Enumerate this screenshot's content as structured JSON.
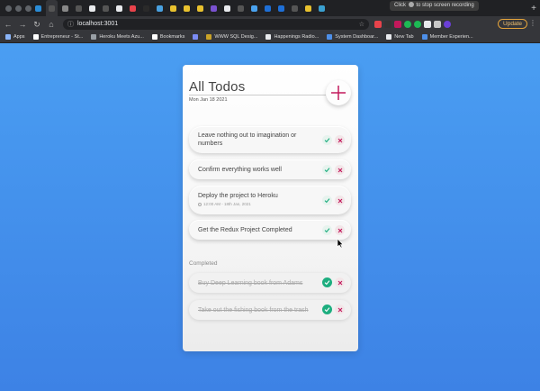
{
  "browser": {
    "tooltip": "Click",
    "tooltip_after": "to stop screen recording",
    "new_tab_glyph": "+",
    "url": "localhost:3001",
    "update_label": "Update",
    "bookmarks": [
      {
        "label": "Apps",
        "color": "#8ab4f8"
      },
      {
        "label": "Entrepreneur - St...",
        "color": "#ffffff"
      },
      {
        "label": "Heroku Meets Azu...",
        "color": "#9aa0a6"
      },
      {
        "label": "Bookmarks",
        "color": "#ffffff"
      },
      {
        "label": "",
        "color": "#7b8cf5"
      },
      {
        "label": "WWW SQL Desig...",
        "color": "#c9a227"
      },
      {
        "label": "Happenings Radio...",
        "color": "#e8eaed"
      },
      {
        "label": "System Dashboar...",
        "color": "#4d8fe8"
      },
      {
        "label": "New Tab",
        "color": "#e8eaed"
      },
      {
        "label": "Member Experien...",
        "color": "#4d8fe8"
      }
    ],
    "tab_colors": [
      "#2a8cd6",
      "#555",
      "#888",
      "#555",
      "#e8eaed",
      "#555",
      "#e8eaed",
      "#e8434b",
      "#2a2a2a",
      "#49a1e0",
      "#e8c12e",
      "#e8c12e",
      "#e8c12e",
      "#7a52d0",
      "#e8eaed",
      "#555",
      "#4aa3f0",
      "#1e6fd6",
      "#1e6fd6",
      "#555",
      "#e8c12e",
      "#3aa0d0"
    ]
  },
  "app": {
    "title": "All Todos",
    "date": "Mon Jan 18 2021",
    "completed_label": "Completed",
    "todos": [
      {
        "text": "Leave nothing out to imagination or numbers",
        "sub": ""
      },
      {
        "text": "Confirm everything works well",
        "sub": ""
      },
      {
        "text": "Deploy the project to Heroku",
        "sub": "12:00 AM - 18th Jan, 2021"
      },
      {
        "text": "Get the Redux Project Completed",
        "sub": ""
      }
    ],
    "completed": [
      {
        "text": "Buy Deep Learning book from Adams"
      },
      {
        "text": "Take out the fishing book from the trash"
      }
    ]
  },
  "colors": {
    "accent": "#c2185b",
    "check": "#1dae7f",
    "delete": "#c2185b",
    "background": "#3d82e5"
  }
}
